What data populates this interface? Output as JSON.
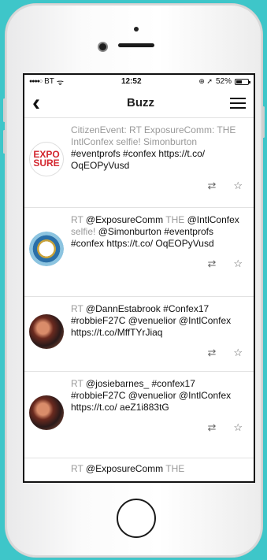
{
  "status": {
    "signal": "●●●●○",
    "carrier": "BT",
    "wifi": "ᯤ",
    "time": "12:52",
    "right_icons": "⊕ ➚",
    "battery_pct": "52%",
    "battery_level": 0.52
  },
  "nav": {
    "back": "‹",
    "title": "Buzz"
  },
  "tweets": [
    {
      "light": "CitizenEvent: RT ExposureComm: THE IntlConfex selfie! Simonburton",
      "dark": "#eventprofs #confex https://t.co/ OqEOPyVusd",
      "avatar_text_1": "EXPO",
      "avatar_text_2": "SURE",
      "avatar_type": "exposure"
    },
    {
      "t1": "RT ",
      "t2": "@ExposureComm",
      "t3": " THE ",
      "t4": "@IntlConfex",
      "t5": " selfie! ",
      "t6": "@Simonburton #eventprofs #confex https://t.co/ OqEOPyVusd",
      "avatar_type": "sunburst"
    },
    {
      "t1": "RT ",
      "t2": "@DannEstabrook",
      "t3": " ",
      "t4": "#Confex17 #robbieF27C @venuelior @IntlConfex https://t.co/MffTYrJiaq",
      "avatar_type": "photo"
    },
    {
      "t1": "RT ",
      "t2": "@josiebarnes_",
      "t3": " ",
      "t4": "#confex17 #robbieF27C @venuelior @IntlConfex https://t.co/ aeZ1i883tG",
      "avatar_type": "photo"
    },
    {
      "t1": "RT ",
      "t2": "@ExposureComm",
      "t3": " THE"
    }
  ],
  "icons": {
    "retweet": "⇄",
    "favorite": "☆"
  }
}
